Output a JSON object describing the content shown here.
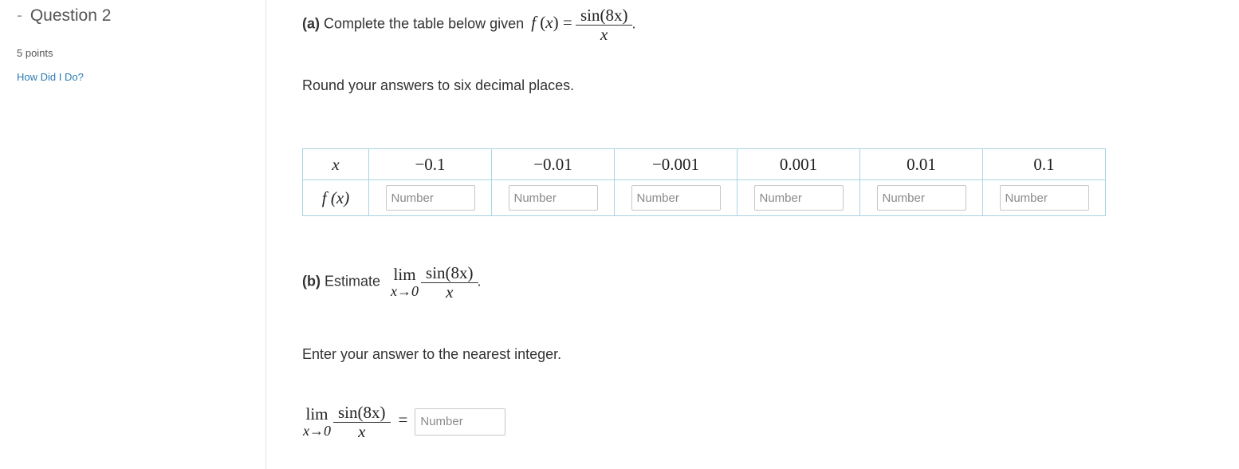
{
  "sidebar": {
    "dash": "-",
    "question_title": "Question 2",
    "points": "5 points",
    "help_link": "How Did I Do?"
  },
  "part_a": {
    "label": "(a)",
    "prompt": "Complete the table below given",
    "func": "f",
    "var": "x",
    "numerator": "sin(8x)",
    "denominator": "x",
    "instruction": "Round your answers to six decimal places."
  },
  "table": {
    "row_header_x": "x",
    "row_header_fx": "f (x)",
    "x_values": [
      "−0.1",
      "−0.01",
      "−0.001",
      "0.001",
      "0.01",
      "0.1"
    ],
    "input_placeholder": "Number"
  },
  "part_b": {
    "label": "(b)",
    "prompt": "Estimate",
    "lim": "lim",
    "lim_under": "x→0",
    "numerator": "sin(8x)",
    "denominator": "x",
    "instruction": "Enter your answer to the nearest integer.",
    "answer_placeholder": "Number"
  },
  "colors": {
    "link": "#2a7ab3",
    "table_border": "#a9d5e3",
    "input_border": "#c7c7c7"
  }
}
